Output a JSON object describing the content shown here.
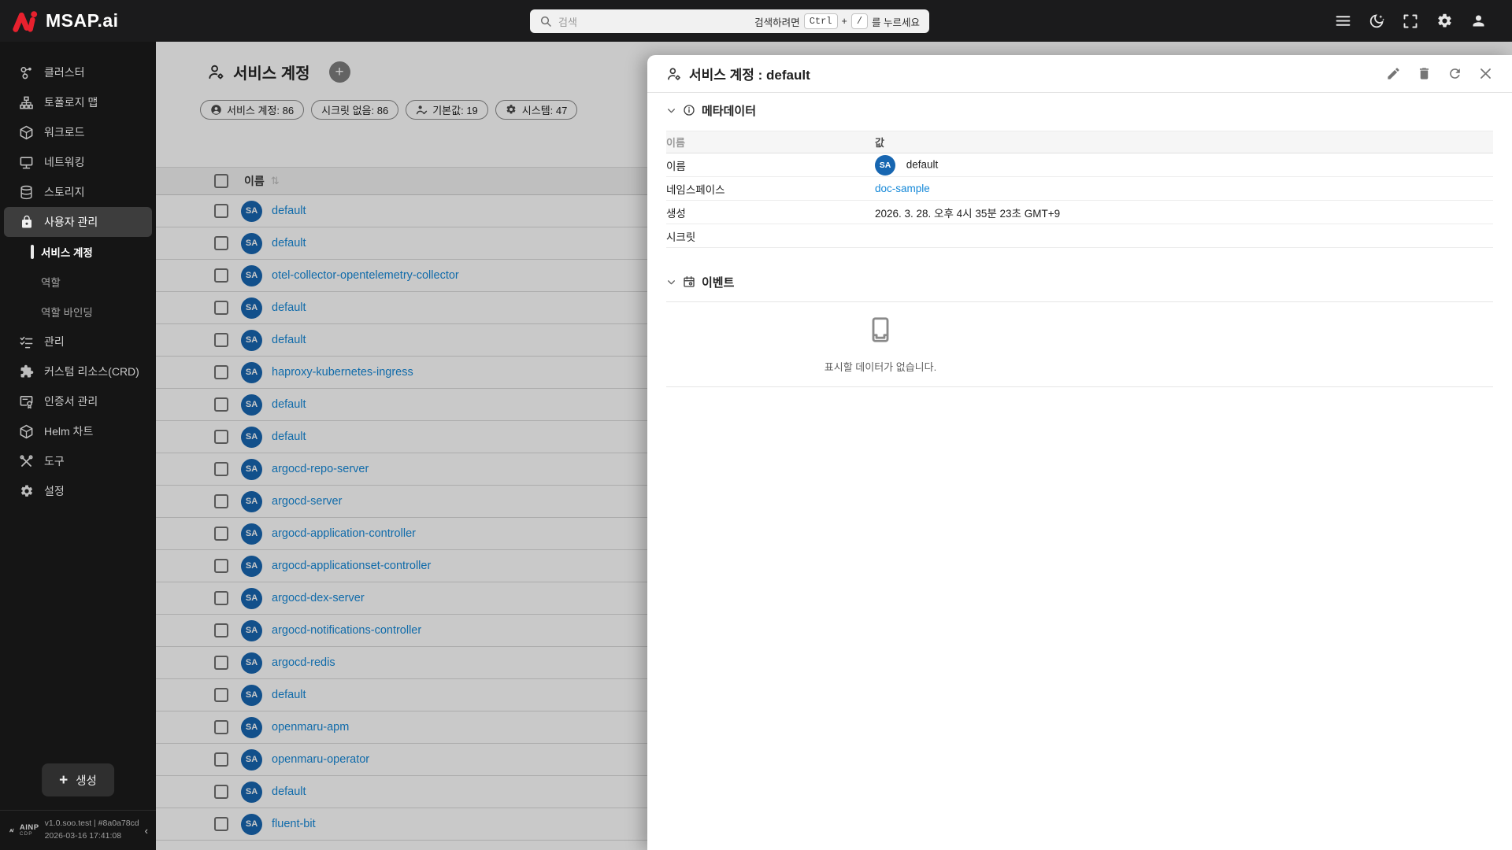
{
  "header": {
    "logo_text": "MSAP.ai",
    "search": {
      "placeholder": "검색",
      "hint_prefix": "검색하려면",
      "key_ctrl": "Ctrl",
      "plus": "+",
      "key_slash": "/",
      "hint_suffix": "를 누르세요"
    },
    "icons": [
      "menu-icon",
      "dark-mode-icon",
      "fullscreen-icon",
      "settings-icon",
      "account-icon"
    ]
  },
  "sidebar": {
    "items": [
      {
        "label": "클러스터",
        "icon": "cluster"
      },
      {
        "label": "토폴로지 맵",
        "icon": "topology"
      },
      {
        "label": "워크로드",
        "icon": "workload"
      },
      {
        "label": "네트워킹",
        "icon": "networking"
      },
      {
        "label": "스토리지",
        "icon": "storage"
      },
      {
        "label": "사용자 관리",
        "icon": "lock",
        "active": true
      },
      {
        "label": "서비스 계정",
        "sub": true,
        "current": true
      },
      {
        "label": "역할",
        "sub": true
      },
      {
        "label": "역할 바인딩",
        "sub": true
      },
      {
        "label": "관리",
        "icon": "checklist"
      },
      {
        "label": "커스텀 리소스(CRD)",
        "icon": "puzzle"
      },
      {
        "label": "인증서 관리",
        "icon": "certificate"
      },
      {
        "label": "Helm 차트",
        "icon": "package"
      },
      {
        "label": "도구",
        "icon": "tools"
      },
      {
        "label": "설정",
        "icon": "gear"
      }
    ],
    "create_label": "생성",
    "footer": {
      "brand": "AINP",
      "brand_sub": "CDP",
      "version": "v1.0.soo.test | #8a0a78cd",
      "timestamp": "2026-03-16 17:41:08",
      "collapse": "‹"
    }
  },
  "main": {
    "title": "서비스 계정",
    "add_label": "+",
    "chips": [
      {
        "icon": "user-circle",
        "label": "서비스 계정: 86"
      },
      {
        "icon": "",
        "label": "시크릿 없음: 86"
      },
      {
        "icon": "user-check",
        "label": "기본값: 19"
      },
      {
        "icon": "gear",
        "label": "시스템: 47"
      }
    ],
    "table": {
      "col_name": "이름",
      "sort_glyph": "⇅",
      "badge": "SA",
      "rows": [
        "default",
        "default",
        "otel-collector-opentelemetry-collector",
        "default",
        "default",
        "haproxy-kubernetes-ingress",
        "default",
        "default",
        "argocd-repo-server",
        "argocd-server",
        "argocd-application-controller",
        "argocd-applicationset-controller",
        "argocd-dex-server",
        "argocd-notifications-controller",
        "argocd-redis",
        "default",
        "openmaru-apm",
        "openmaru-operator",
        "default",
        "fluent-bit"
      ]
    }
  },
  "drawer": {
    "title": "서비스 계정 : default",
    "metadata": {
      "section_title": "메타데이터",
      "col_name": "이름",
      "col_value": "값",
      "badge": "SA",
      "rows": [
        {
          "label": "이름",
          "value": "default"
        },
        {
          "label": "네임스페이스",
          "value": "doc-sample"
        },
        {
          "label": "생성",
          "value": "2026. 3. 28. 오후 4시 35분 23초 GMT+9"
        },
        {
          "label": "시크릿",
          "value": ""
        }
      ]
    },
    "events": {
      "section_title": "이벤트",
      "empty_text": "표시할 데이터가 없습니다."
    }
  },
  "colors": {
    "badge_blue": "#1766b1",
    "link_blue": "#1588d8",
    "logo_red": "#e8212e",
    "topbar_bg": "#1b1b1c",
    "sidebar_bg": "#151515"
  }
}
